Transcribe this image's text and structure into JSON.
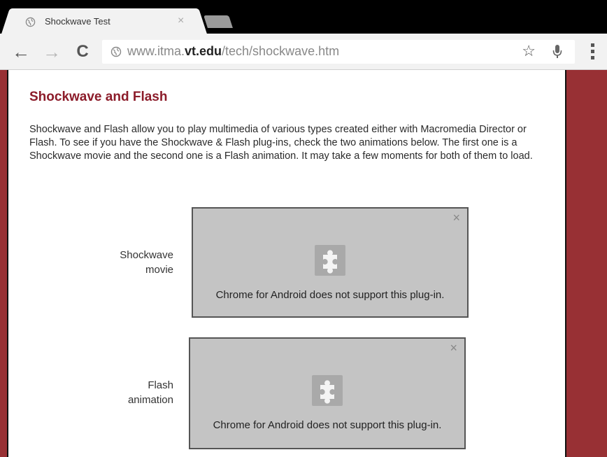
{
  "browser": {
    "tab": {
      "title": "Shockwave Test",
      "close": "×"
    },
    "toolbar": {
      "back": "←",
      "forward": "→",
      "reload": "C",
      "url_prefix": "www.itma.",
      "url_host": "vt.edu",
      "url_path": "/tech/shockwave.htm",
      "bookmark": "☆"
    }
  },
  "page": {
    "title": "Shockwave and Flash",
    "intro": "Shockwave and Flash allow you to play multimedia of various types created either with Macromedia Director or Flash. To see if you have the Shockwave & Flash plug-ins, check the two animations below. The first one is a Shockwave movie and the second one is a Flash animation. It may take a few moments for both of them to load.",
    "plugins": [
      {
        "label_line1": "Shockwave",
        "label_line2": "movie",
        "message": "Chrome for Android does not support this plug-in.",
        "close": "×"
      },
      {
        "label_line1": "Flash",
        "label_line2": "animation",
        "message": "Chrome for Android does not support this plug-in.",
        "close": "×"
      }
    ]
  },
  "colors": {
    "page_background": "#983034",
    "title": "#8c1c2a",
    "plugin_box": "#c4c4c4"
  },
  "icons": [
    "globe-icon",
    "close-icon",
    "back-arrow-icon",
    "forward-arrow-icon",
    "reload-icon",
    "star-icon",
    "microphone-icon",
    "overflow-menu-icon",
    "puzzle-piece-icon"
  ]
}
